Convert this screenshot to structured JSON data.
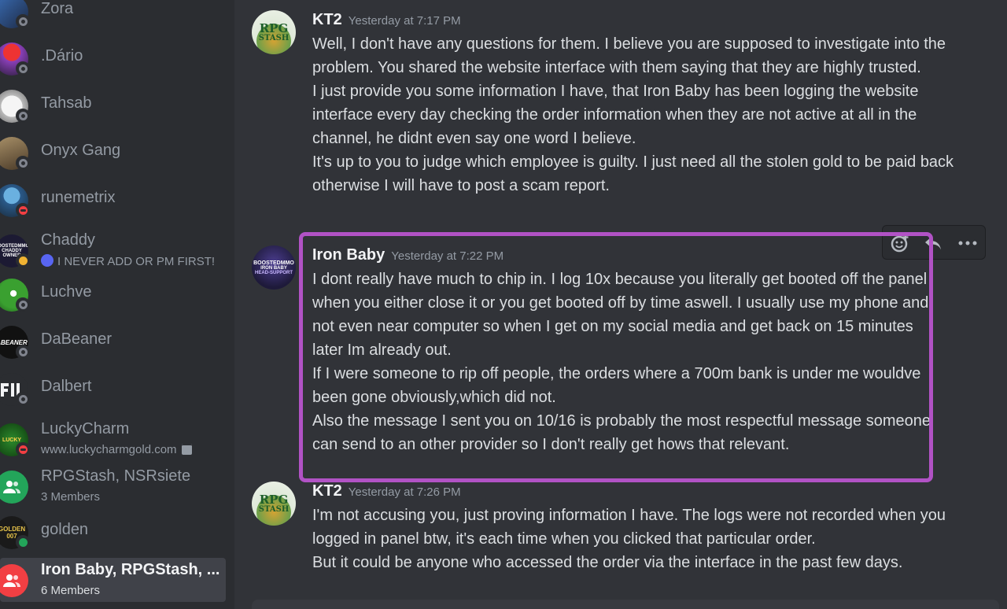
{
  "sidebar": {
    "dms": [
      {
        "name": "Zora",
        "status": "offline",
        "avatar": ""
      },
      {
        "name": ".Dário",
        "status": "offline",
        "avatar": ""
      },
      {
        "name": "Tahsab",
        "status": "offline",
        "avatar": ""
      },
      {
        "name": "Onyx Gang",
        "status": "offline",
        "avatar": ""
      },
      {
        "name": "runemetrix",
        "status": "dnd",
        "avatar": ""
      },
      {
        "name": "Chaddy",
        "status": "idle",
        "sub": "I NEVER ADD OR PM FIRST!",
        "avatar": "BOOSTEDMMO CHADDY OWNER"
      },
      {
        "name": "Luchve",
        "status": "offline",
        "avatar": ""
      },
      {
        "name": "DaBeaner",
        "status": "offline",
        "avatar": "ABEANER"
      },
      {
        "name": "Dalbert",
        "status": "offline",
        "avatar": ""
      },
      {
        "name": "LuckyCharm",
        "status": "dnd",
        "sub": "www.luckycharmgold.com",
        "avatar": "LUCKY"
      },
      {
        "name": "RPGStash, NSRsiete",
        "status": "none",
        "sub": "3 Members",
        "avatar": ""
      },
      {
        "name": "golden",
        "status": "online",
        "avatar": "GOLDEN 007"
      },
      {
        "name": "Iron Baby, RPGStash, ...",
        "status": "none",
        "sub": "6 Members",
        "avatar": ""
      }
    ]
  },
  "messages": [
    {
      "author": "KT2",
      "timestamp": "Yesterday at 7:17 PM",
      "avatar": {
        "line1": "RPG",
        "line2": "STASH"
      },
      "paragraphs": [
        "Well, I don't have any questions for them. I believe you are supposed to investigate into the problem. You shared the website interface with them saying that they are highly trusted.",
        "I just provide you some information I have, that Iron Baby has been logging the website interface every day checking the order information when they are not active at all in the channel, he didnt even say one word I believe.",
        "It's up to you to judge which employee is guilty. I just need all the stolen gold to be paid back otherwise I will have to post a scam report."
      ]
    },
    {
      "author": "Iron Baby",
      "timestamp": "Yesterday at 7:22 PM",
      "avatar": {
        "line1": "BOOSTEDMMO",
        "line2": "IRON BABY",
        "line3": "HEAD-SUPPORT"
      },
      "paragraphs": [
        "I dont really have much to chip in. I log 10x because you literally get booted off the panel when you either close it or you get booted off by time aswell. I usually use my phone and not even near computer so when I get on my social media and get back on 15 minutes later Im already out.",
        "If I were someone to rip off people, the orders where a 700m bank is under me wouldve been gone obviously,which did not.",
        "Also the message I sent you on 10/16 is probably the most respectful message someone can send to an other provider so I don't really get hows that relevant."
      ]
    },
    {
      "author": "KT2",
      "timestamp": "Yesterday at 7:26 PM",
      "avatar": {
        "line1": "RPG",
        "line2": "STASH"
      },
      "paragraphs": [
        "I'm not accusing you, just proving information I have. The logs were not recorded when you logged in panel btw, it's each time when you clicked that particular order.",
        "But it could be anyone who accessed the order via the interface in the past few days."
      ]
    }
  ],
  "toolbar": {
    "icons": [
      "add-reaction-icon",
      "reply-icon",
      "more-icon"
    ]
  },
  "colors": {
    "highlight": "#b152c5",
    "group_green": "#23a55a",
    "group_red": "#f23f43"
  }
}
